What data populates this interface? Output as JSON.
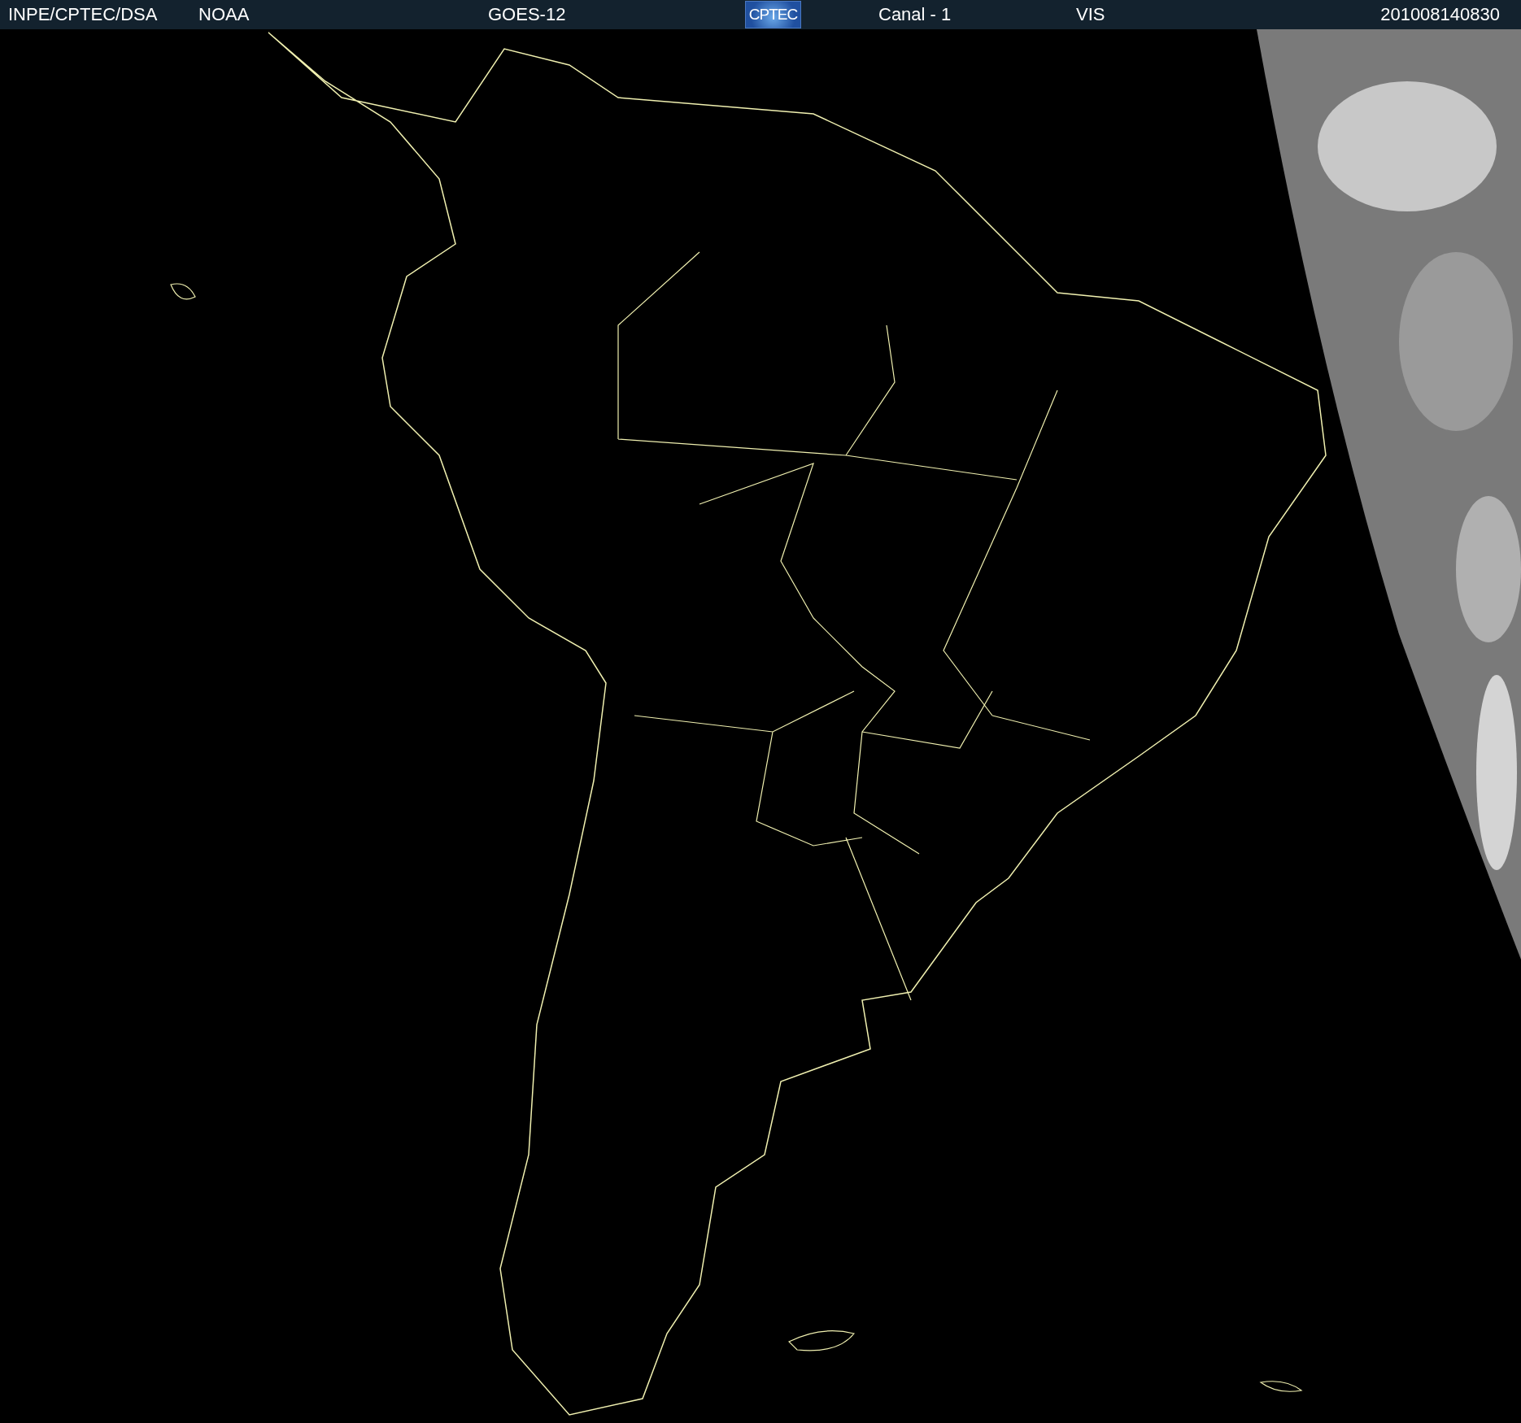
{
  "header": {
    "source": "INPE/CPTEC/DSA",
    "agency": "NOAA",
    "satellite": "GOES-12",
    "logo": "CPTEC",
    "channel": "Canal - 1",
    "band": "VIS",
    "timestamp": "201008140830"
  }
}
